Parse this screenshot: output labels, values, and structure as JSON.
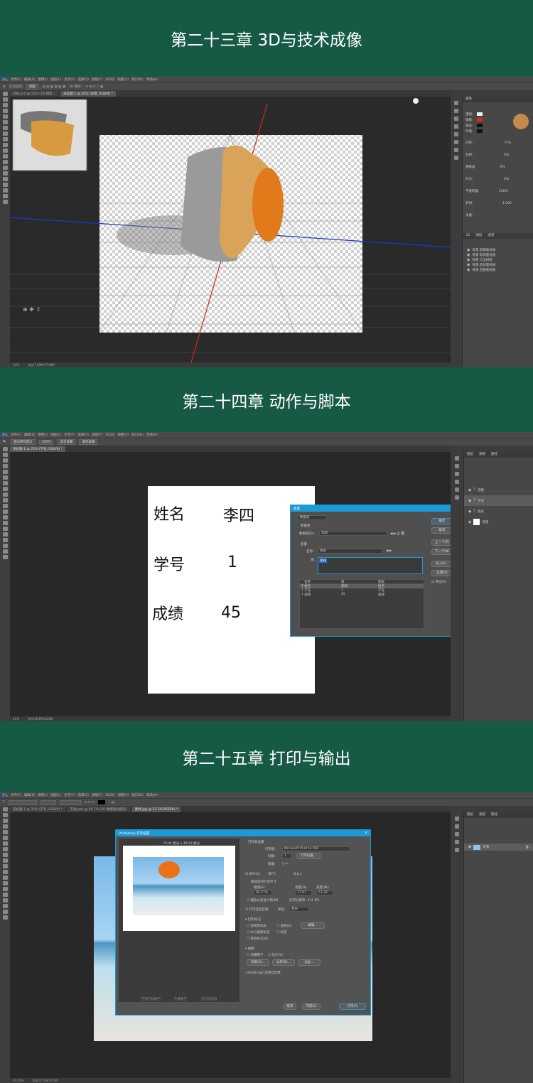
{
  "section1": {
    "title": "第二十三章 3D与技术成像"
  },
  "section2": {
    "title": "第二十四章 动作与脚本"
  },
  "section3": {
    "title": "第二十五章 打印与输出"
  },
  "ps1": {
    "menu": [
      "文件(F)",
      "编辑(E)",
      "图像(I)",
      "图层(L)",
      "文字(Y)",
      "选择(S)",
      "滤镜(T)",
      "3D(D)",
      "视图(V)",
      "窗口(W)",
      "帮助(H)"
    ],
    "opt": {
      "mode_label": "3D 模式:",
      "auto_label": "自动选择:",
      "auto_value": "图层"
    },
    "tabs": [
      "开始.psd @ 50% (3D 相机...",
      "未标题-1 @ 50% (背景, RGB/8) *"
    ],
    "status": {
      "zoom": "50%",
      "doc": "文档:7.69M/17.06M"
    },
    "panel": {
      "title": "属性",
      "rows": [
        {
          "label": "漫射:",
          "value": ""
        },
        {
          "label": "镜像:",
          "value": ""
        },
        {
          "label": "发光:",
          "value": ""
        },
        {
          "label": "环境:",
          "value": ""
        },
        {
          "label": "闪亮:",
          "value": "77%"
        },
        {
          "label": "反射:",
          "value": "0%"
        },
        {
          "label": "粗糙度:",
          "value": "0%"
        },
        {
          "label": "凹凸:",
          "value": "0%"
        },
        {
          "label": "不透明度:",
          "value": "100%"
        },
        {
          "label": "折射:",
          "value": "1.000"
        },
        {
          "label": "法线:",
          "value": ""
        }
      ],
      "tabs3d": [
        "3D",
        "图层",
        "通道"
      ],
      "layers": [
        "背景 前膨胀材质",
        "背景 前斜面材质",
        "背景 凸出材质",
        "背景 后斜面材质",
        "背景 后膨胀材质"
      ]
    }
  },
  "ps2": {
    "menu": [
      "文件(F)",
      "编辑(E)",
      "图像(I)",
      "图层(L)",
      "文字(Y)",
      "选择(S)",
      "滤镜(T)",
      "3D(D)",
      "视图(V)",
      "窗口(W)",
      "帮助(H)"
    ],
    "opt": {
      "btn1": "滚动所有窗口",
      "btn2": "100%",
      "btn3": "适合屏幕",
      "btn4": "填充屏幕"
    },
    "tabs": [
      "未标题-1 @ 25% (学号, RGB/8) *"
    ],
    "status": {
      "zoom": "25%",
      "doc": "文档:26.6M/32.8M"
    },
    "doc": {
      "name_label": "姓名",
      "name_value": "李四",
      "id_label": "学号",
      "id_value": "1",
      "score_label": "成绩",
      "score_value": "45"
    },
    "dialog": {
      "title": "变量",
      "define": "数据组",
      "data_set_label": "数据组",
      "data_set_field_label": "数据组(D):",
      "data_set_value": "李四",
      "var_label": "变量",
      "name_label": "名称:",
      "name_value": "姓名",
      "value_label": "值:",
      "value_value": "李四",
      "cols": [
        "名称",
        "值",
        "图层"
      ],
      "rows": [
        [
          "姓名",
          "李四",
          "姓名"
        ],
        [
          "学号",
          "1",
          "学号"
        ],
        [
          "成绩",
          "45",
          "成绩"
        ]
      ],
      "buttons": [
        "确定",
        "取消",
        "上一个(P)",
        "下一个(N)",
        "导入(I)...",
        "应用(A)"
      ],
      "preview": "预览(V)"
    },
    "panel": {
      "tabs": [
        "图层",
        "通道",
        "路径"
      ],
      "layers": [
        "成绩",
        "学号",
        "姓名",
        "背景"
      ]
    }
  },
  "ps3": {
    "menu": [
      "文件(F)",
      "编辑(E)",
      "图像(I)",
      "图层(L)",
      "文字(Y)",
      "选择(S)",
      "滤镜(T)",
      "3D(D)",
      "视图(V)",
      "窗口(W)",
      "帮助(H)"
    ],
    "tabs": [
      "未标题-1 @ 25% (学号, RGB/8) *",
      "开始.psd @ 66.7% (3D 数据驱动图形)",
      "素材.jpg @ 33.3%(RGB/8) *"
    ],
    "status": {
      "zoom": "33.33%",
      "doc": "文档:17.1M/17.1M"
    },
    "dialog": {
      "title": "Photoshop 打印设置",
      "paper": "70.04 厘米 x 49.58 厘米",
      "printer_section": "打印机设置",
      "printer_label": "打印机:",
      "printer_value": "Microsoft Print to PDF",
      "copies_label": "份数:",
      "copies_value": "1",
      "print_settings_btn": "打印设置...",
      "layout_label": "版面:",
      "position_label": "居中(C)",
      "top_label": "顶(T):",
      "left_label": "左(L):",
      "scaled_label": "缩放后的打印尺寸",
      "scale_label": "缩放(S):",
      "scale_value": "95.27%",
      "height_label": "高度(H):",
      "height_value": "37.97",
      "width_label": "宽度(W):",
      "width_value": "57.26",
      "fit_label": "缩放以适合介质(M)",
      "ppi_label": "打印分辨率: 314 PPI",
      "print_area_label": "打印选定区域",
      "unit_label": "单位:",
      "unit_value": "厘米",
      "marks_section": "打印标记",
      "corner": "角裁剪标志",
      "desc": "说明(D)",
      "edit_btn": "编辑...",
      "center": "中心裁剪标志",
      "label": "标签",
      "reg": "套准标记(R)",
      "func_section": "函数",
      "emulsion": "药膜朝下",
      "negative": "负片(V)",
      "bg_btn": "背景(K)...",
      "border_btn": "边界(B)...",
      "bleed_btn": "出血...",
      "postscript": "PostScript 选项已禁用",
      "cancel": "取消",
      "done": "完成(E)",
      "print": "打印(P)",
      "bottom_links": [
        "匹配打印颜色",
        "色域警告",
        "显示纸张白"
      ]
    },
    "panel": {
      "tabs": [
        "图层",
        "通道",
        "路径"
      ],
      "layers": [
        "背景"
      ]
    }
  }
}
